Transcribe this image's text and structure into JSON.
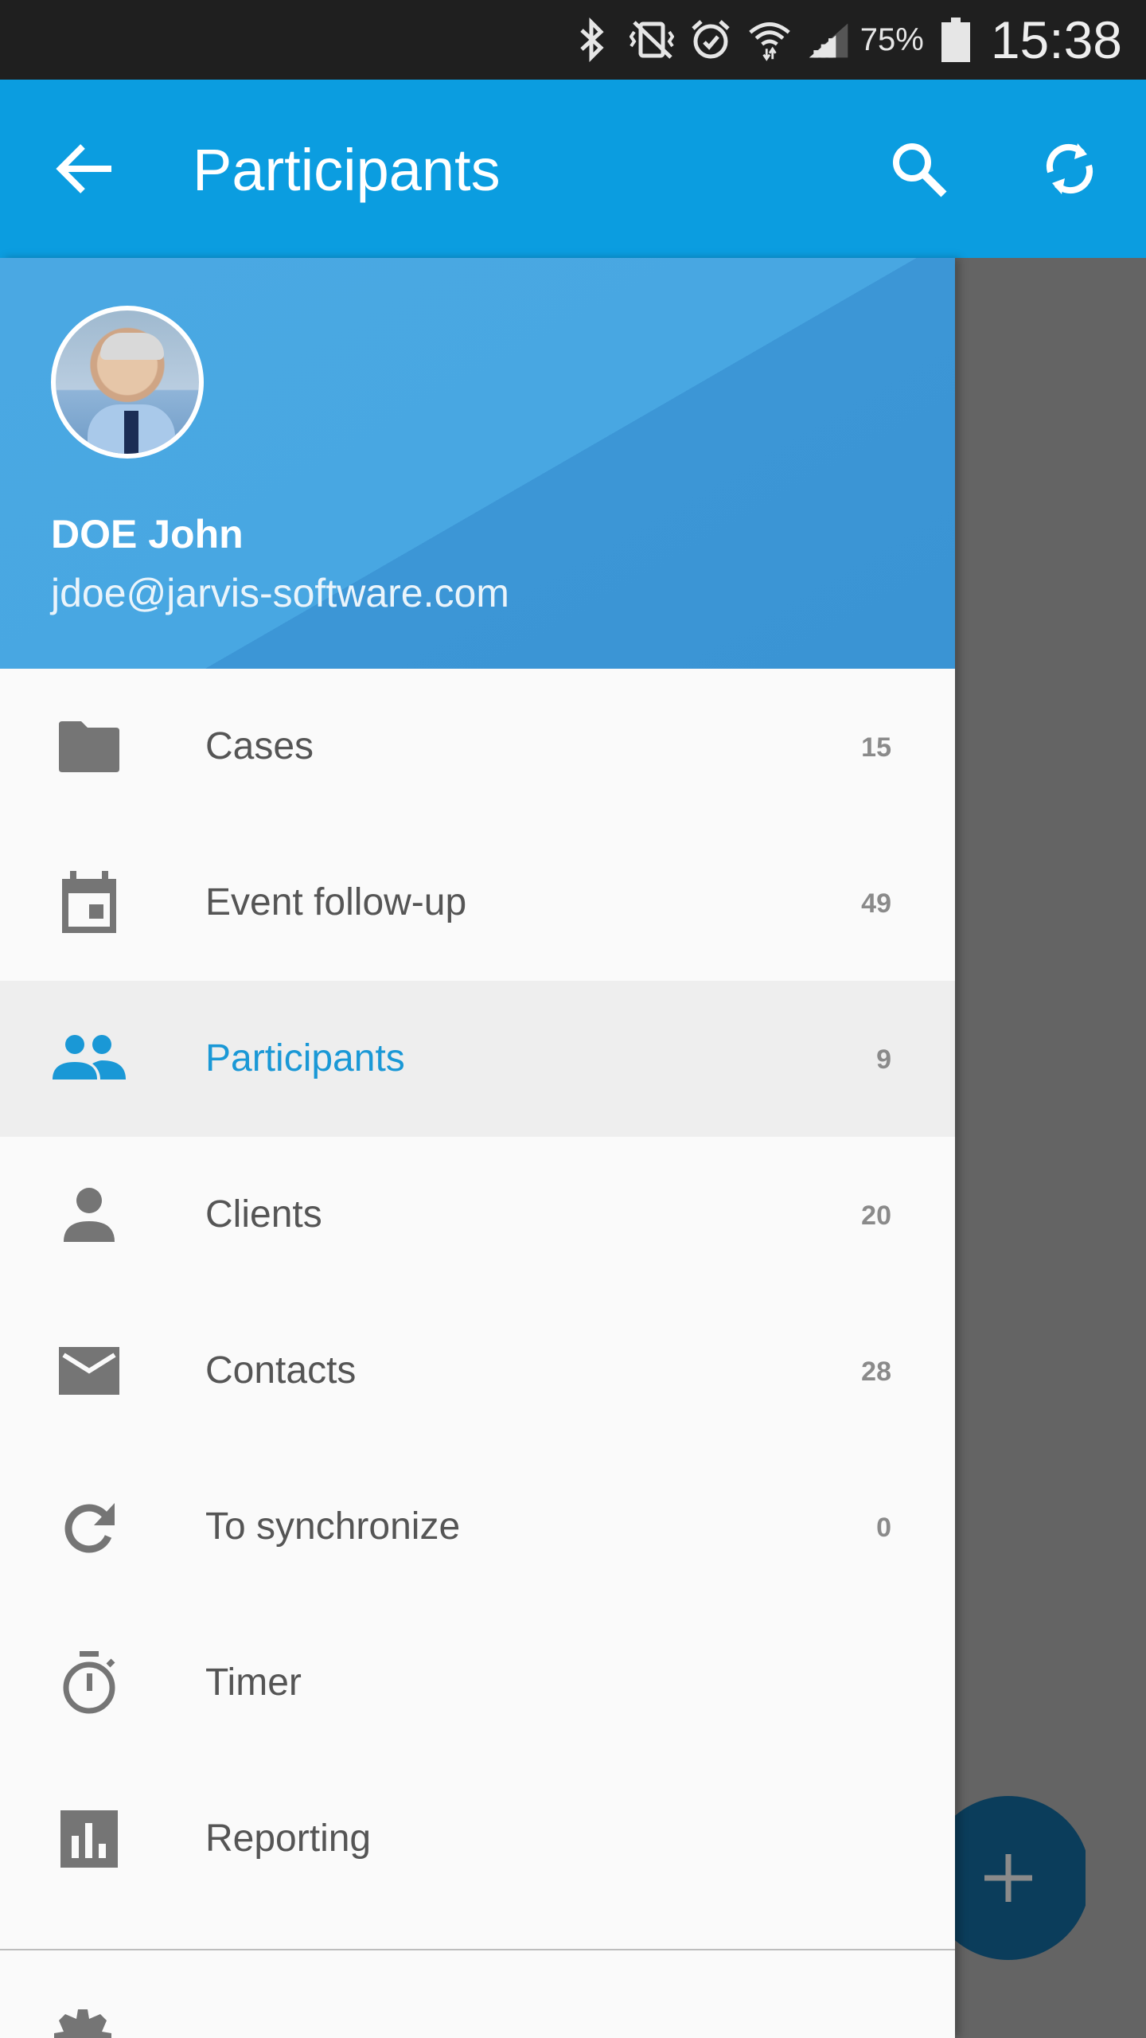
{
  "status_bar": {
    "battery_percent": "75%",
    "time": "15:38",
    "icons": [
      "bluetooth-icon",
      "vibrate-icon",
      "alarm-icon",
      "wifi-icon",
      "signal-icon",
      "battery-icon"
    ]
  },
  "app_bar": {
    "title": "Participants",
    "icons": [
      "back-arrow-icon",
      "search-icon",
      "sync-icon"
    ],
    "color": "#0b9de0"
  },
  "drawer": {
    "user": {
      "name": "DOE John",
      "email": "jdoe@jarvis-software.com"
    },
    "accent_color": "#1a98d6",
    "items": [
      {
        "label": "Cases",
        "count": "15",
        "icon": "folder-icon",
        "active": false
      },
      {
        "label": "Event follow-up",
        "count": "49",
        "icon": "calendar-icon",
        "active": false
      },
      {
        "label": "Participants",
        "count": "9",
        "icon": "people-icon",
        "active": true
      },
      {
        "label": "Clients",
        "count": "20",
        "icon": "person-icon",
        "active": false
      },
      {
        "label": "Contacts",
        "count": "28",
        "icon": "mail-icon",
        "active": false
      },
      {
        "label": "To synchronize",
        "count": "0",
        "icon": "refresh-icon",
        "active": false
      },
      {
        "label": "Timer",
        "count": "",
        "icon": "timer-icon",
        "active": false
      },
      {
        "label": "Reporting",
        "count": "",
        "icon": "bar-chart-icon",
        "active": false
      }
    ]
  },
  "fab": {
    "icon": "plus-icon"
  }
}
